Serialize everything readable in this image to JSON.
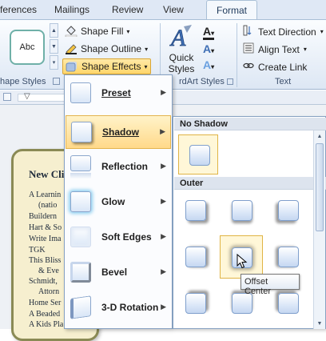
{
  "tabs": [
    "ferences",
    "Mailings",
    "Review",
    "View",
    "Format"
  ],
  "ribbon": {
    "shape_style_sample": "Abc",
    "shape_fill": "Shape Fill",
    "shape_outline": "Shape Outline",
    "shape_effects": "Shape Effects",
    "shape_styles_group": "hape Styles",
    "quick_styles_line1": "Quick",
    "quick_styles_line2": "Styles",
    "wordart_group": "rdArt Styles",
    "text_direction": "Text Direction",
    "align_text": "Align Text",
    "create_link": "Create Link",
    "text_group": "Text"
  },
  "document": {
    "card_title": "New Cli",
    "lines": [
      "A Learnin",
      "(natio",
      "Buildern",
      "Hart & So",
      "Write Ima",
      "TGK",
      "This Bliss",
      "& Eve",
      "Schmidt,",
      "Attorn",
      "Home Ser",
      "A Beaded",
      "A Kids Pla"
    ]
  },
  "effects_menu": {
    "items": [
      "Preset",
      "Shadow",
      "Reflection",
      "Glow",
      "Soft Edges",
      "Bevel",
      "3-D Rotation"
    ]
  },
  "shadow_submenu": {
    "no_shadow_header": "No Shadow",
    "outer_header": "Outer",
    "tooltip": "Offset Center"
  },
  "colors": {
    "accent": "#ffd66b",
    "ribbon": "#dfe8f5",
    "card": "#f6efcf"
  }
}
